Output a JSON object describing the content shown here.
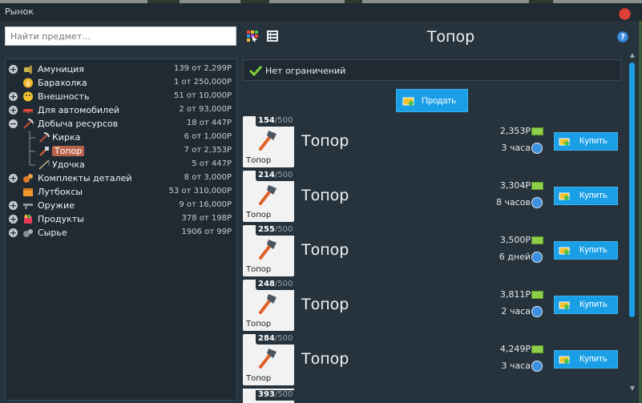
{
  "window": {
    "title": "Рынок"
  },
  "search": {
    "placeholder": "Найти предмет..."
  },
  "header": {
    "title": "Топор",
    "help": "?"
  },
  "categories": [
    {
      "toggle": "+",
      "label": "Амуниция",
      "count": "139 от 2,299Р",
      "icon": "ammo-icon",
      "level": 0
    },
    {
      "toggle": "",
      "label": "Барахолка",
      "count": "1 от 250,000Р",
      "icon": "coin-icon",
      "level": 0
    },
    {
      "toggle": "+",
      "label": "Внешность",
      "count": "51 от 10,000Р",
      "icon": "face-icon",
      "level": 0
    },
    {
      "toggle": "+",
      "label": "Для автомобилей",
      "count": "2 от 93,000Р",
      "icon": "car-icon",
      "level": 0
    },
    {
      "toggle": "−",
      "label": "Добыча ресурсов",
      "count": "18 от 447Р",
      "icon": "pickaxe-icon",
      "level": 0
    },
    {
      "toggle": "",
      "label": "Кирка",
      "count": "6 от 1,000Р",
      "icon": "pickaxe-icon",
      "level": 1
    },
    {
      "toggle": "",
      "label": "Топор",
      "count": "7 от 2,353Р",
      "icon": "axe-icon",
      "level": 1,
      "selected": true
    },
    {
      "toggle": "",
      "label": "Удочка",
      "count": "5 от 447Р",
      "icon": "fishing-rod-icon",
      "level": 1
    },
    {
      "toggle": "+",
      "label": "Комплекты деталей",
      "count": "8 от 3,000Р",
      "icon": "gears-icon",
      "level": 0
    },
    {
      "toggle": "",
      "label": "Лутбоксы",
      "count": "53 от 310,000Р",
      "icon": "box-icon",
      "level": 0
    },
    {
      "toggle": "+",
      "label": "Оружие",
      "count": "9 от 16,000Р",
      "icon": "gun-icon",
      "level": 0
    },
    {
      "toggle": "+",
      "label": "Продукты",
      "count": "378 от 198Р",
      "icon": "food-icon",
      "level": 0
    },
    {
      "toggle": "+",
      "label": "Сырье",
      "count": "1906 от 99Р",
      "icon": "ore-icon",
      "level": 0
    }
  ],
  "filter": {
    "label": "Нет ограничений"
  },
  "sell_button": {
    "label": "Продать"
  },
  "listings": [
    {
      "qty": "154",
      "max": "/500",
      "thumb_label": "Топор",
      "name": "Топор",
      "price": "2,353Р",
      "duration": "3 часа",
      "buy_label": "Купить"
    },
    {
      "qty": "214",
      "max": "/500",
      "thumb_label": "Топор",
      "name": "Топор",
      "price": "3,304Р",
      "duration": "8 часов",
      "buy_label": "Купить"
    },
    {
      "qty": "255",
      "max": "/500",
      "thumb_label": "Топор",
      "name": "Топор",
      "price": "3,500Р",
      "duration": "6 дней",
      "buy_label": "Купить"
    },
    {
      "qty": "248",
      "max": "/500",
      "thumb_label": "Топор",
      "name": "Топор",
      "price": "3,811Р",
      "duration": "2 часа",
      "buy_label": "Купить"
    },
    {
      "qty": "284",
      "max": "/500",
      "thumb_label": "Топор",
      "name": "Топор",
      "price": "4,249Р",
      "duration": "3 часа",
      "buy_label": "Купить"
    }
  ],
  "partial_listing": {
    "qty": "393",
    "max": "/500"
  },
  "colors": {
    "accent": "#1a9ee6",
    "selected": "#b9644a",
    "background": "#26333d",
    "panel": "#1f2a33"
  }
}
